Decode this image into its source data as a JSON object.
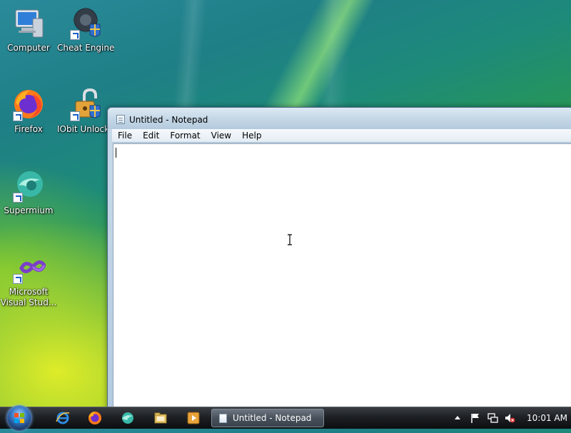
{
  "desktop": {
    "icons": [
      {
        "label": "Computer"
      },
      {
        "label": "Cheat Engine"
      },
      {
        "label": "Firefox"
      },
      {
        "label": "IObit Unlocker"
      },
      {
        "label": "Supermium"
      },
      {
        "label": "Microsoft Visual Stud..."
      }
    ]
  },
  "window": {
    "title": "Untitled - Notepad",
    "menu": [
      "File",
      "Edit",
      "Format",
      "View",
      "Help"
    ],
    "content": ""
  },
  "taskbar": {
    "task_label": "Untitled - Notepad",
    "clock": "10:01 AM"
  },
  "colors": {
    "taskbar": "#1d2024",
    "window_frame": "#b3cadf",
    "accent": "#3a7cc8"
  }
}
